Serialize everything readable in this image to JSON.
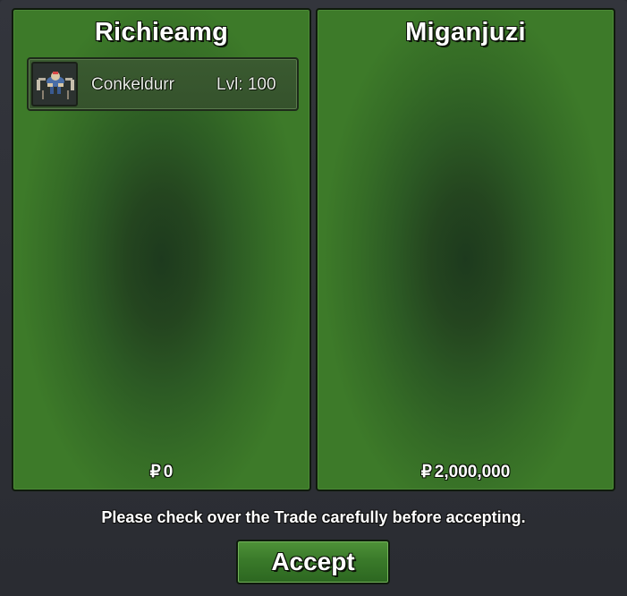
{
  "trade": {
    "left": {
      "trader_name": "Richieamg",
      "items": [
        {
          "icon": "conkeldurr-sprite-icon",
          "name": "Conkeldurr",
          "level": "Lvl: 100"
        }
      ],
      "currency_symbol": "₽",
      "money": "0"
    },
    "right": {
      "trader_name": "Miganjuzi",
      "items": [],
      "currency_symbol": "₽",
      "money": "2,000,000"
    },
    "notice": "Please check over the Trade carefully before accepting.",
    "accept_label": "Accept"
  },
  "colors": {
    "panel_green": "#3d7a29",
    "panel_center": "#1d3a1e",
    "button_green": "#3a7a2a",
    "background": "#2b2d33"
  }
}
